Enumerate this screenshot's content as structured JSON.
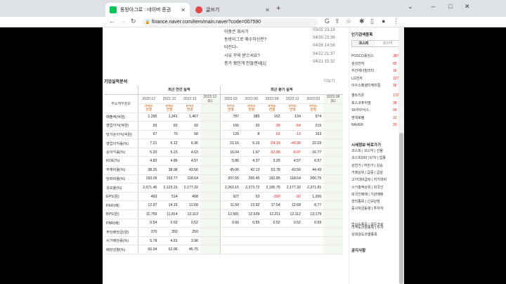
{
  "browser": {
    "tabs": [
      {
        "title": "동방아그로 : 네이버 증권",
        "fav_color": "#03c75a",
        "fav_glyph": "N"
      },
      {
        "title": "글쓰기",
        "fav_color": "#e54545",
        "fav_glyph": "T"
      }
    ],
    "url": "finance.naver.com/item/main.naver?code=007590",
    "new_tab": "+",
    "minimize": "–",
    "maximize": "□",
    "close": "✕"
  },
  "news": [
    {
      "title": "이중은 화사기",
      "date": "05/02 23:18"
    },
    {
      "title": "동방이그로 매수하신분?",
      "date": "04/30 23:36"
    },
    {
      "title": "터진다~",
      "date": "04/26 14:58"
    },
    {
      "title": "시유 꾸욱 받으셔요?",
      "date": "04/22 21:37"
    },
    {
      "title": "종가 뭣인게 만들렌네[1]",
      "date": "04/21 15:32"
    }
  ],
  "section": {
    "title": "기업실적분석",
    "more": "더보기"
  },
  "table": {
    "row_header": "주요재무정보",
    "annual_header": "최근 연간 실적",
    "quarter_header": "최근 분기 실적",
    "annual_years": [
      "2020.12",
      "2021.12",
      "2022.12",
      "2023.12\n(E)"
    ],
    "quarter_years": [
      "2022.03",
      "2022.06",
      "2022.09",
      "2022.12",
      "2023.03",
      "2023.06\n(E)"
    ],
    "ifrs": "IFRS\n연결",
    "rows": [
      {
        "label": "매출액(억원)",
        "a": [
          "1,295",
          "1,341",
          "1,467",
          ""
        ],
        "q": [
          "787",
          "385",
          "162",
          "134",
          "974",
          ""
        ]
      },
      {
        "label": "영업이익(억원)",
        "a": [
          "93",
          "82",
          "93",
          ""
        ],
        "q": [
          "166",
          "20",
          "-39",
          "-54",
          "215",
          ""
        ]
      },
      {
        "label": "당기순이익(억원)",
        "a": [
          "67",
          "70",
          "68",
          ""
        ],
        "q": [
          "126",
          "8",
          "-53",
          "-13",
          "163",
          ""
        ]
      },
      {
        "label": "영업이익률(%)",
        "a": [
          "7.21",
          "6.12",
          "6.36",
          ""
        ],
        "q": [
          "21.16",
          "5.19",
          "-24.19",
          "-40.38",
          "22.03",
          ""
        ]
      },
      {
        "label": "순이익률(%)",
        "a": [
          "5.20",
          "5.23",
          "4.63",
          ""
        ],
        "q": [
          "16.04",
          "1.97",
          "-32.88",
          "-9.47",
          "16.77",
          ""
        ]
      },
      {
        "label": "ROE(%)",
        "a": [
          "4.83",
          "4.86",
          "4.57",
          ""
        ],
        "q": [
          "5.86",
          "4.37",
          "3.25",
          "4.57",
          "6.57",
          ""
        ]
      },
      {
        "label": "부채비율(%)",
        "a": [
          "38.25",
          "38.98",
          "43.56",
          ""
        ],
        "q": [
          "45.06",
          "42.13",
          "53.78",
          "43.56",
          "44.43",
          ""
        ]
      },
      {
        "label": "당좌비율(%)",
        "a": [
          "193.09",
          "153.77",
          "118.64",
          ""
        ],
        "q": [
          "207.65",
          "255.45",
          "192.85",
          "118.64",
          "200.75",
          ""
        ]
      },
      {
        "label": "유보율(%)",
        "a": [
          "2,071.46",
          "2,123.31",
          "2,177.32",
          ""
        ],
        "q": [
          "2,263.15",
          "2,273.72",
          "2,195.75",
          "2,177.32",
          "2,371.81",
          ""
        ]
      },
      {
        "label": "EPS(원)",
        "a": [
          "493",
          "514",
          "498",
          ""
        ],
        "q": [
          "927",
          "53",
          "-390",
          "-92",
          "1,200",
          ""
        ]
      },
      {
        "label": "PER(배)",
        "a": [
          "12.97",
          "14.15",
          "12.68",
          ""
        ],
        "q": [
          "11.50",
          "13.92",
          "17.54",
          "12.68",
          "8.77",
          ""
        ]
      },
      {
        "label": "BPS(원)",
        "a": [
          "11,759",
          "11,814",
          "12,112",
          ""
        ],
        "q": [
          "12,581",
          "12,639",
          "12,211",
          "12,112",
          "13,179",
          ""
        ]
      },
      {
        "label": "PBR(배)",
        "a": [
          "0.54",
          "0.62",
          "0.52",
          ""
        ],
        "q": [
          "0.60",
          "0.55",
          "0.52",
          "0.52",
          "0.59",
          ""
        ]
      },
      {
        "label": "주당배당금(원)",
        "a": [
          "370",
          "350",
          "250",
          ""
        ],
        "q": [
          "",
          "",
          "",
          "",
          "",
          ""
        ]
      },
      {
        "label": "시가배당률(%)",
        "a": [
          "5.78",
          "4.81",
          "3.96",
          ""
        ],
        "q": [
          "",
          "",
          "",
          "",
          "",
          ""
        ]
      },
      {
        "label": "배당성향(%)",
        "a": [
          "66.04",
          "62.06",
          "45.75",
          ""
        ],
        "q": [
          "",
          "",
          "",
          "",
          "",
          ""
        ]
      }
    ]
  },
  "sidebar": {
    "popular_title": "인기검색종목",
    "tabs": [
      "코스피",
      "코스닥"
    ],
    "items1": [
      {
        "name": "POSCO홀딩스",
        "val": "387"
      },
      {
        "name": "삼성전자",
        "val": "65"
      },
      {
        "name": "두산에너빌리티",
        "val": "16"
      },
      {
        "name": "LG전자",
        "val": "127"
      },
      {
        "name": "이수스페셜티케미컬",
        "val": "16"
      }
    ],
    "items2": [
      {
        "name": "셀트리온",
        "val": "172"
      },
      {
        "name": "포스코퓨처엠",
        "val": "38"
      },
      {
        "name": "SK하이닉스",
        "val": "99"
      },
      {
        "name": "현대로템",
        "val": "31"
      },
      {
        "name": "NAVER",
        "val": "20"
      }
    ],
    "market_title": "시세정보 바로가기",
    "market_lines": [
      "코스피 | 코스닥 | 선물",
      "코스피200 | ETF | 업종",
      "상한가 | 하한가 | 상승",
      "거래상위 | 급증 | 급감",
      "고가대비급락 | 저가대비",
      "시가총액상위 | 외국인",
      "외국인매매 | 기관매매",
      "관리종목 | 신규상장",
      "증시자금동향 | 투자자",
      "업상승종목 | 골든크로",
      "이격도과열종목 | 투자",
      "상대강도과열종목"
    ],
    "notice_title": "공지사항"
  }
}
